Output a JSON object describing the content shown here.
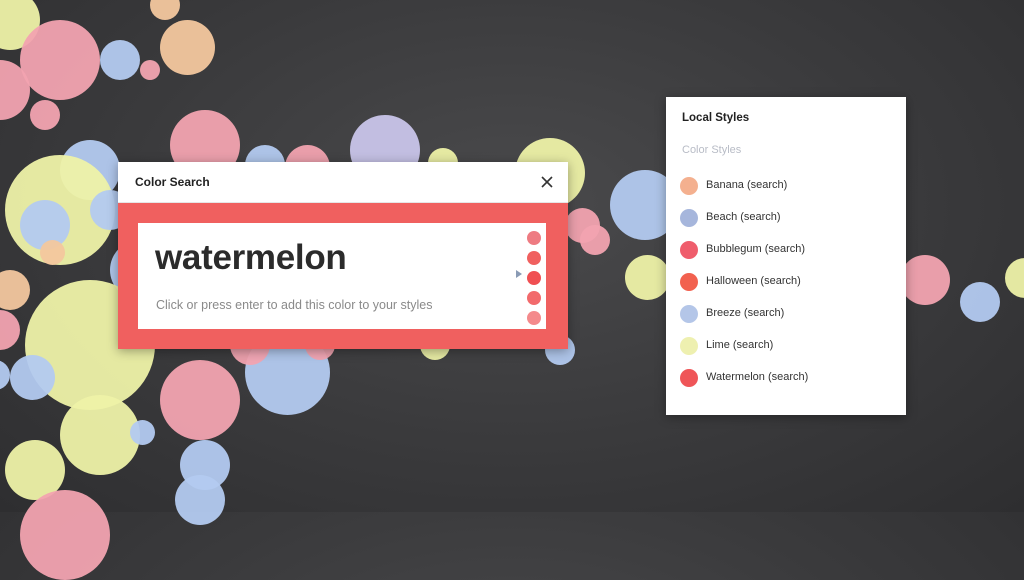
{
  "colors": {
    "watermelon": "#f0605f",
    "pink": "#f2a3b0",
    "blue": "#b3caf0",
    "yellow": "#eef2a8",
    "peach": "#f3c79e",
    "lavender": "#c9c5ea"
  },
  "dialog": {
    "title": "Color Search",
    "close_icon": "close-icon",
    "result": {
      "name": "watermelon",
      "hint": "Click or press enter to add this color to your styles"
    },
    "shades": [
      "#ee7b82",
      "#f0605f",
      "#f04f52",
      "#f26a6c",
      "#f48a8c"
    ]
  },
  "panel": {
    "title": "Local Styles",
    "subtitle": "Color Styles",
    "items": [
      {
        "label": "Banana (search)",
        "color": "#f4b08f"
      },
      {
        "label": "Beach (search)",
        "color": "#a6b6dc"
      },
      {
        "label": "Bubblegum (search)",
        "color": "#ef5d6c"
      },
      {
        "label": "Halloween (search)",
        "color": "#f2614f"
      },
      {
        "label": "Breeze (search)",
        "color": "#b4c6e8"
      },
      {
        "label": "Lime (search)",
        "color": "#eef0b0"
      },
      {
        "label": "Watermelon (search)",
        "color": "#ef5558"
      }
    ]
  }
}
